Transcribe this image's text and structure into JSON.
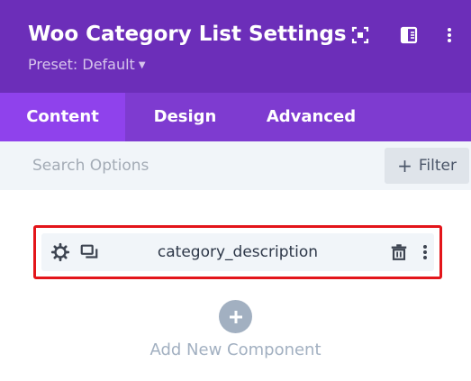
{
  "header": {
    "title": "Woo Category List Settings",
    "preset_label": "Preset: Default",
    "icons": [
      "expand-icon",
      "sidebar-toggle-icon",
      "more-vertical-icon"
    ],
    "colors": {
      "background": "#6c2eb9",
      "text": "#ffffff"
    }
  },
  "tabs": [
    {
      "label": "Content",
      "active": true
    },
    {
      "label": "Design",
      "active": false
    },
    {
      "label": "Advanced",
      "active": false
    }
  ],
  "search": {
    "placeholder": "Search Options",
    "value": ""
  },
  "filter": {
    "label": "Filter"
  },
  "component": {
    "label": "category_description",
    "icons": [
      "gear-icon",
      "duplicate-icon",
      "trash-icon",
      "more-vertical-icon"
    ],
    "highlight_color": "#e3151a"
  },
  "add_component": {
    "label": "Add New Component"
  }
}
